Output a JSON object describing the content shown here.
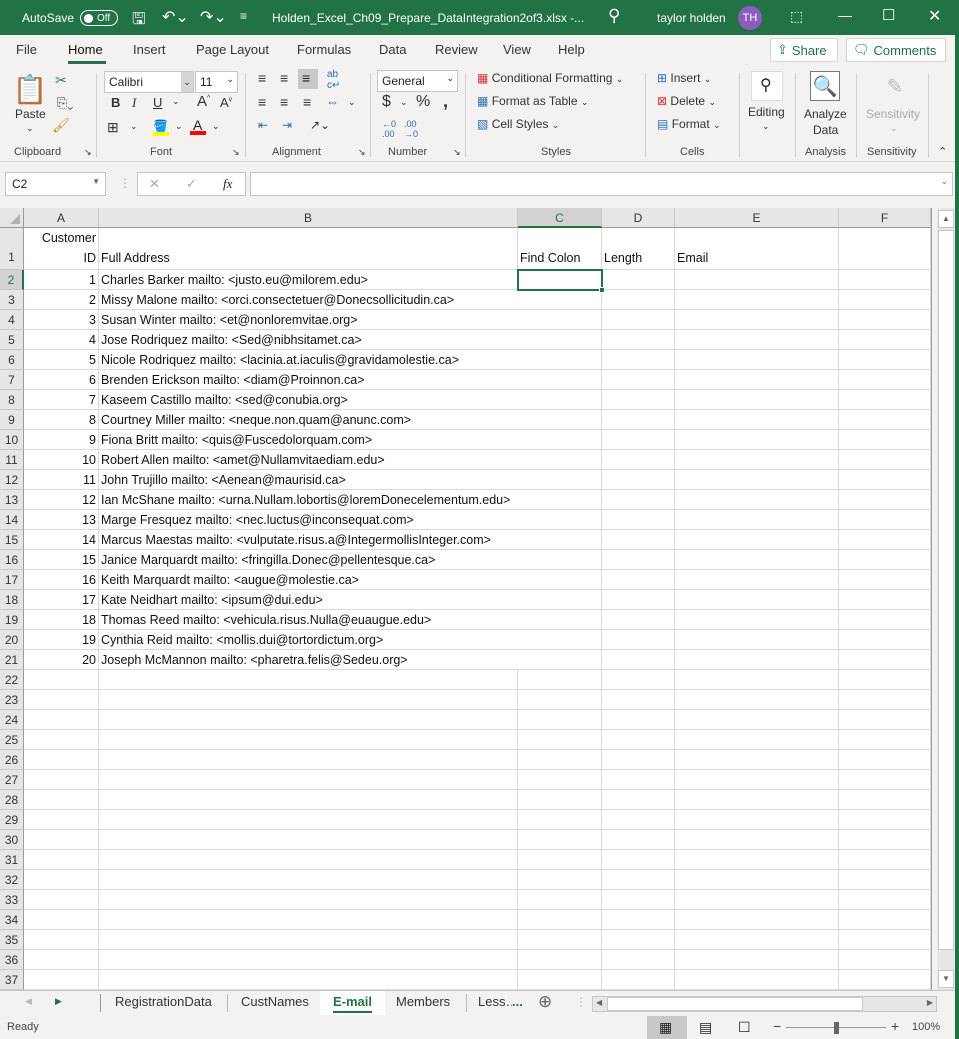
{
  "titlebar": {
    "autosave_label": "AutoSave",
    "autosave_state": "Off",
    "filename": "Holden_Excel_Ch09_Prepare_DataIntegration2of3.xlsx  -...",
    "user_name": "taylor holden",
    "user_initials": "TH",
    "accent_color": "#217346"
  },
  "menu": {
    "tabs": [
      "File",
      "Home",
      "Insert",
      "Page Layout",
      "Formulas",
      "Data",
      "Review",
      "View",
      "Help"
    ],
    "active": "Home",
    "share_label": "Share",
    "comments_label": "Comments"
  },
  "ribbon": {
    "clipboard": {
      "paste_label": "Paste",
      "group_label": "Clipboard"
    },
    "font": {
      "font_name": "Calibri",
      "font_size": "11",
      "group_label": "Font",
      "highlight_color": "#ffff00",
      "font_color": "#ff0000"
    },
    "alignment": {
      "group_label": "Alignment"
    },
    "number": {
      "format": "General",
      "group_label": "Number"
    },
    "styles": {
      "conditional_formatting": "Conditional Formatting",
      "format_as_table": "Format as Table",
      "cell_styles": "Cell Styles",
      "group_label": "Styles"
    },
    "cells": {
      "insert": "Insert",
      "delete": "Delete",
      "format": "Format",
      "group_label": "Cells"
    },
    "editing": {
      "label": "Editing"
    },
    "analysis": {
      "analyze_data_line1": "Analyze",
      "analyze_data_line2": "Data",
      "group_label": "Analysis"
    },
    "sensitivity": {
      "label": "Sensitivity",
      "group_label": "Sensitivity"
    }
  },
  "formula_bar": {
    "name_box": "C2",
    "fx_label": "fx",
    "formula": ""
  },
  "sheet": {
    "columns": [
      "A",
      "B",
      "C",
      "D",
      "E",
      "F"
    ],
    "selected_column": "C",
    "selected_row": "2",
    "header_row": {
      "A_line1": "Customer",
      "A_line2": "ID",
      "B": "Full Address",
      "C": "Find Colon",
      "D": "Length",
      "E": "Email"
    },
    "rows": [
      {
        "id": "1",
        "address": "Charles Barker mailto: <justo.eu@milorem.edu>"
      },
      {
        "id": "2",
        "address": "Missy Malone mailto: <orci.consectetuer@Donecsollicitudin.ca>"
      },
      {
        "id": "3",
        "address": "Susan Winter mailto: <et@nonloremvitae.org>"
      },
      {
        "id": "4",
        "address": "Jose Rodriquez mailto: <Sed@nibhsitamet.ca>"
      },
      {
        "id": "5",
        "address": "Nicole Rodriquez mailto: <lacinia.at.iaculis@gravidamolestie.ca>"
      },
      {
        "id": "6",
        "address": "Brenden Erickson mailto: <diam@Proinnon.ca>"
      },
      {
        "id": "7",
        "address": "Kaseem Castillo mailto: <sed@conubia.org>"
      },
      {
        "id": "8",
        "address": "Courtney Miller mailto: <neque.non.quam@anunc.com>"
      },
      {
        "id": "9",
        "address": "Fiona Britt mailto: <quis@Fuscedolorquam.com>"
      },
      {
        "id": "10",
        "address": "Robert Allen mailto: <amet@Nullamvitaediam.edu>"
      },
      {
        "id": "11",
        "address": "John Trujillo mailto: <Aenean@maurisid.ca>"
      },
      {
        "id": "12",
        "address": "Ian McShane mailto: <urna.Nullam.lobortis@loremDonecelementum.edu>"
      },
      {
        "id": "13",
        "address": "Marge Fresquez mailto: <nec.luctus@inconsequat.com>"
      },
      {
        "id": "14",
        "address": "Marcus Maestas mailto: <vulputate.risus.a@IntegermollisInteger.com>"
      },
      {
        "id": "15",
        "address": "Janice Marquardt mailto: <fringilla.Donec@pellentesque.ca>"
      },
      {
        "id": "16",
        "address": "Keith Marquardt mailto: <augue@molestie.ca>"
      },
      {
        "id": "17",
        "address": "Kate Neidhart mailto: <ipsum@dui.edu>"
      },
      {
        "id": "18",
        "address": "Thomas Reed mailto: <vehicula.risus.Nulla@euaugue.edu>"
      },
      {
        "id": "19",
        "address": "Cynthia Reid mailto: <mollis.dui@tortordictum.org>"
      },
      {
        "id": "20",
        "address": "Joseph McMannon mailto: <pharetra.felis@Sedeu.org>"
      }
    ],
    "row_numbers": [
      "1",
      "2",
      "3",
      "4",
      "5",
      "6",
      "7",
      "8",
      "9",
      "10",
      "11",
      "12",
      "13",
      "14",
      "15",
      "16",
      "17",
      "18",
      "19",
      "20",
      "21",
      "22",
      "23",
      "24",
      "25",
      "26",
      "27",
      "28",
      "29",
      "30",
      "31",
      "32",
      "33",
      "34",
      "35",
      "36",
      "37"
    ]
  },
  "sheet_tabs": {
    "tabs": [
      "RegistrationData",
      "CustNames",
      "E-mail",
      "Members",
      "Less…"
    ],
    "active": "E-mail",
    "more": "..."
  },
  "status": {
    "text": "Ready",
    "zoom": "100%",
    "zoom_fraction": 0.5
  }
}
